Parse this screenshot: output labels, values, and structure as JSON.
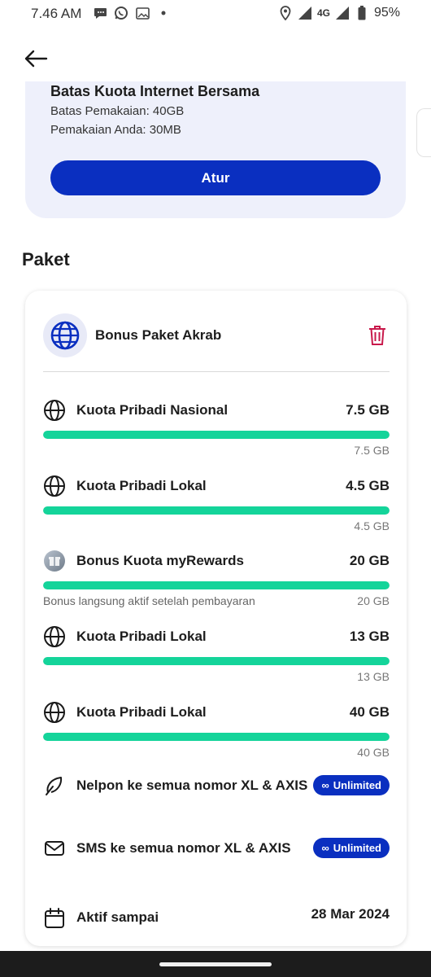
{
  "status_bar": {
    "time": "7.46 AM",
    "network": "4G",
    "battery": "95%",
    "left_icons": [
      "chat-bubble-icon",
      "whatsapp-icon",
      "gallery-icon",
      "dot-icon"
    ],
    "right_icons": [
      "location-icon",
      "signal-icon",
      "network-4g-icon",
      "battery-icon"
    ]
  },
  "header": {
    "back_icon": "arrow-left-icon"
  },
  "quota_limit": {
    "title": "Batas Kuota Internet Bersama",
    "limit_text": "Batas Pemakaian: 40GB",
    "usage_text": "Pemakaian Anda: 30MB",
    "button_label": "Atur"
  },
  "section": {
    "title": "Paket"
  },
  "package": {
    "name": "Bonus Paket Akrab",
    "icon": "globe-icon",
    "delete_icon": "trash-icon",
    "items": [
      {
        "icon": "globe-icon",
        "label": "Kuota Pribadi Nasional",
        "value": "7.5 GB",
        "remaining": "7.5 GB",
        "note": "",
        "fill": 1.0
      },
      {
        "icon": "globe-icon",
        "label": "Kuota Pribadi Lokal",
        "value": "4.5 GB",
        "remaining": "4.5 GB",
        "note": "",
        "fill": 1.0
      },
      {
        "icon": "gift-icon",
        "label": "Bonus Kuota myRewards",
        "value": "20 GB",
        "remaining": "20 GB",
        "note": "Bonus langsung aktif setelah pembayaran",
        "fill": 1.0
      },
      {
        "icon": "globe-icon",
        "label": "Kuota Pribadi Lokal",
        "value": "13 GB",
        "remaining": "13 GB",
        "note": "",
        "fill": 1.0
      },
      {
        "icon": "globe-icon",
        "label": "Kuota Pribadi Lokal",
        "value": "40 GB",
        "remaining": "40 GB",
        "note": "",
        "fill": 1.0
      }
    ],
    "services": [
      {
        "icon": "phone-leaf-icon",
        "label": "Nelpon ke semua nomor XL & AXIS",
        "badge": "Unlimited"
      },
      {
        "icon": "envelope-icon",
        "label": "SMS ke semua nomor XL & AXIS",
        "badge": "Unlimited"
      }
    ],
    "active_until": {
      "icon": "calendar-icon",
      "label": "Aktif sampai",
      "date": "28 Mar 2024"
    }
  },
  "colors": {
    "primary": "#0a2fc0",
    "progress": "#14d49a",
    "delete": "#c8194b",
    "card_bg": "#eef0fb"
  }
}
